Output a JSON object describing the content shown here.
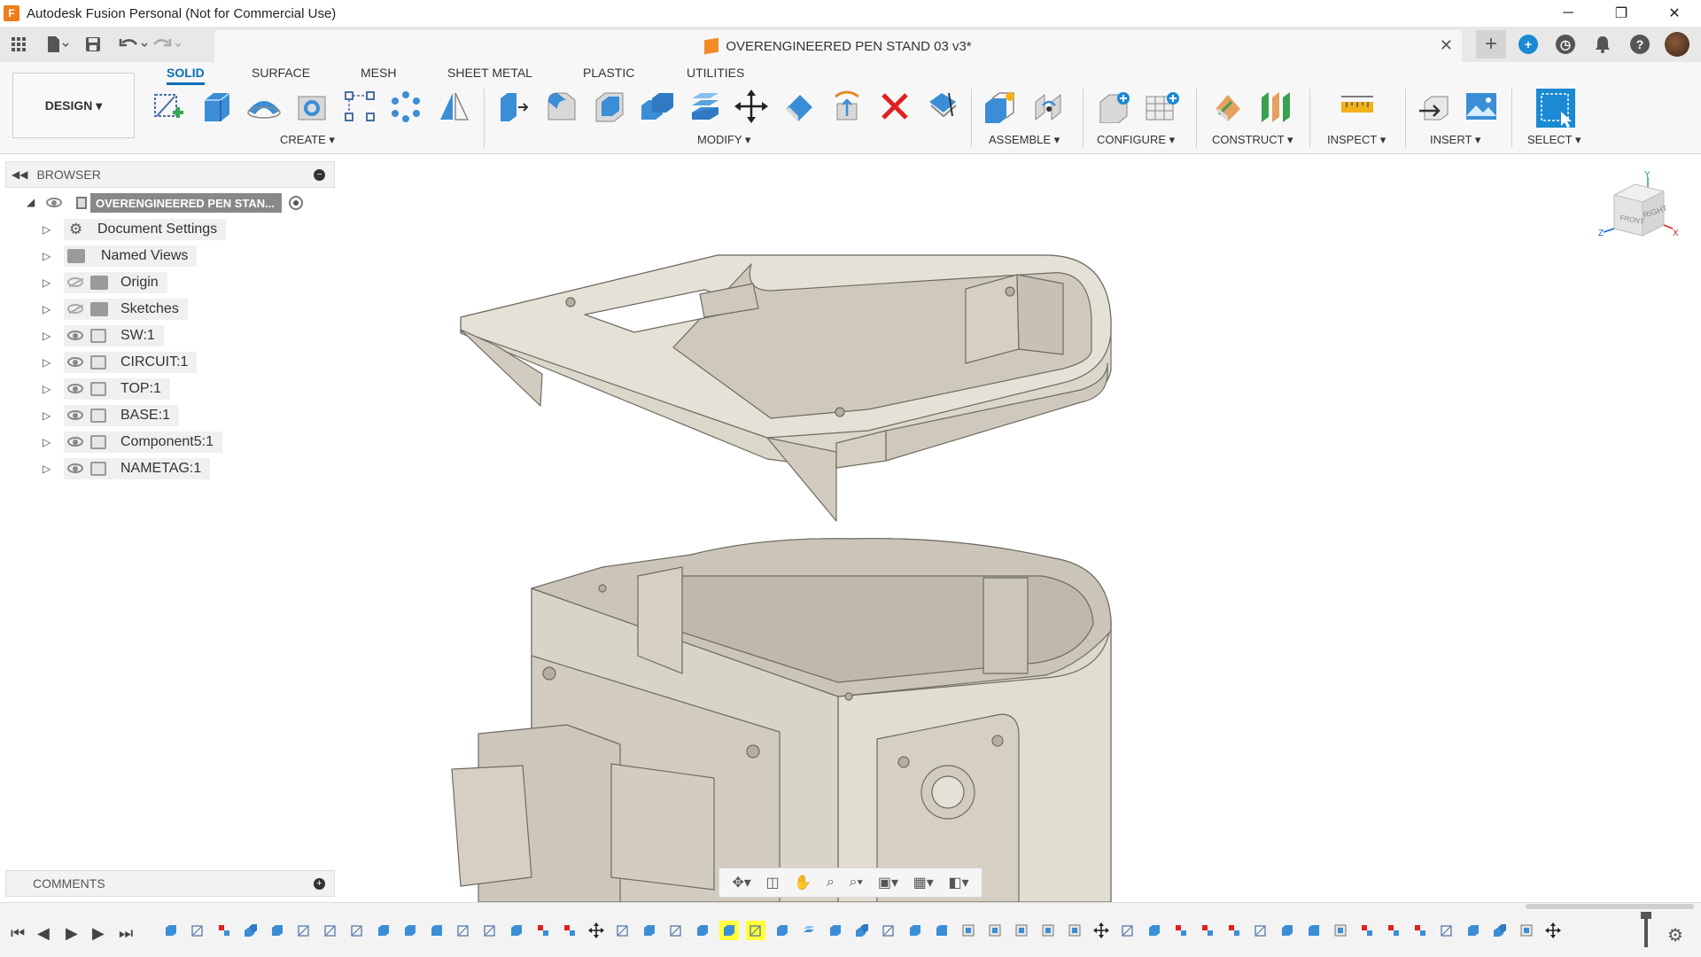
{
  "window": {
    "title": "Autodesk Fusion Personal (Not for Commercial Use)",
    "app_logo": "F",
    "minimize": "─",
    "restore": "❐",
    "close": "✕"
  },
  "quick_access": {
    "grid_icon": "▦",
    "file_icon": "▤",
    "save_icon": "💾",
    "undo_icon": "↶",
    "redo_icon": "↷"
  },
  "document_tab": {
    "title": "OVERENGINEERED PEN STAND 03 v3*",
    "close": "✕",
    "new_tab": "+"
  },
  "workspace": {
    "label": "DESIGN ▾"
  },
  "ribbon_tabs": [
    "SOLID",
    "SURFACE",
    "MESH",
    "SHEET METAL",
    "PLASTIC",
    "UTILITIES"
  ],
  "ribbon_groups": {
    "create": "CREATE ▾",
    "modify": "MODIFY ▾",
    "assemble": "ASSEMBLE ▾",
    "configure": "CONFIGURE ▾",
    "construct": "CONSTRUCT ▾",
    "inspect": "INSPECT ▾",
    "insert": "INSERT ▾",
    "select": "SELECT ▾"
  },
  "browser": {
    "title": "BROWSER",
    "root": "OVERENGINEERED PEN STAN...",
    "items": [
      {
        "label": "Document Settings"
      },
      {
        "label": "Named Views"
      },
      {
        "label": "Origin"
      },
      {
        "label": "Sketches"
      },
      {
        "label": "SW:1"
      },
      {
        "label": "CIRCUIT:1"
      },
      {
        "label": "TOP:1"
      },
      {
        "label": "BASE:1"
      },
      {
        "label": "Component5:1"
      },
      {
        "label": "NAMETAG:1"
      }
    ]
  },
  "comments": {
    "title": "COMMENTS"
  },
  "viewcube": {
    "front": "FRONT",
    "right": "RIGHT",
    "x": "X",
    "y": "Y",
    "z": "Z"
  },
  "colors": {
    "accent": "#0a6fb8",
    "model": "#e6e1d6",
    "timeline_highlight": "#ffff3a"
  }
}
